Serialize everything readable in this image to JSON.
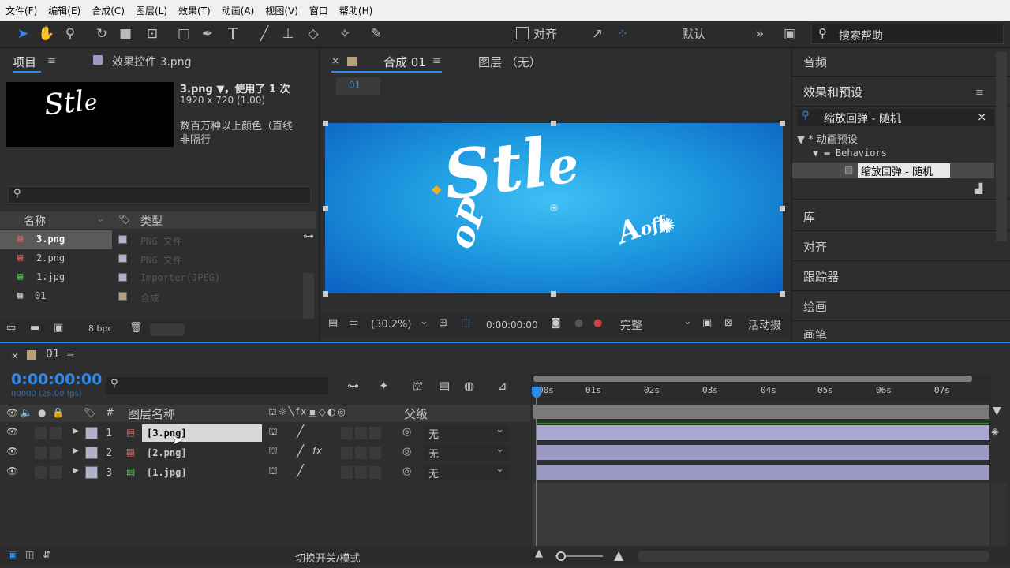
{
  "menu": [
    "文件(F)",
    "编辑(E)",
    "合成(C)",
    "图层(L)",
    "效果(T)",
    "动画(A)",
    "视图(V)",
    "窗口",
    "帮助(H)"
  ],
  "toolbar": {
    "align_label": "对齐",
    "workspace": "默认",
    "search_help": "搜索帮助"
  },
  "project_panel": {
    "tab_project": "项目",
    "tab_effects": "效果控件 3.png",
    "file_title": "3.png ▼，使用了 1 次",
    "file_dims": "1920 x 720 (1.00)",
    "file_colors": "数百万种以上颜色（直线",
    "file_alpha": "非隔行",
    "col_name": "名称",
    "col_type": "类型",
    "items": [
      {
        "name": "3.png",
        "type": "PNG 文件"
      },
      {
        "name": "2.png",
        "type": "PNG 文件"
      },
      {
        "name": "1.jpg",
        "type": "Importer(JPEG)"
      },
      {
        "name": "01",
        "type": "合成"
      }
    ],
    "bpc": "8 bpc"
  },
  "comp_panel": {
    "tab_comp": "合成 01",
    "tab_layer": "图层 （无）",
    "comp_name_tab": "01",
    "zoom": "(30.2%)",
    "time": "0:00:00:00",
    "quality": "完整",
    "camera": "活动摄"
  },
  "right_panel": {
    "audio": "音频",
    "effects_title": "效果和预设",
    "search_value": "缩放回弹 - 随机",
    "tree_root": "* 动画预设",
    "tree_folder": "Behaviors",
    "tree_item": "缩放回弹 - 随机",
    "library": "库",
    "align": "对齐",
    "tracker": "跟踪器",
    "paint": "绘画",
    "brush": "画笔"
  },
  "timeline": {
    "comp_tab": "01",
    "current_time": "0:00:00:00",
    "fps_info": "00000 (25.00 fps)",
    "col_layer_name": "图层名称",
    "col_hash": "#",
    "col_parent": "父级",
    "ruler": [
      "00s",
      "01s",
      "02s",
      "03s",
      "04s",
      "05s",
      "06s",
      "07s"
    ],
    "layers": [
      {
        "num": "1",
        "name": "[3.png]",
        "parent": "无",
        "fx": ""
      },
      {
        "num": "2",
        "name": "[2.png]",
        "parent": "无",
        "fx": "fx"
      },
      {
        "num": "3",
        "name": "[1.jpg]",
        "parent": "无",
        "fx": ""
      }
    ],
    "toggle_modes": "切换开关/模式"
  },
  "colors": {
    "accent": "#2d8ceb",
    "timeline_bar": "#9a9ac4",
    "canvas": "#1e9ae0"
  }
}
